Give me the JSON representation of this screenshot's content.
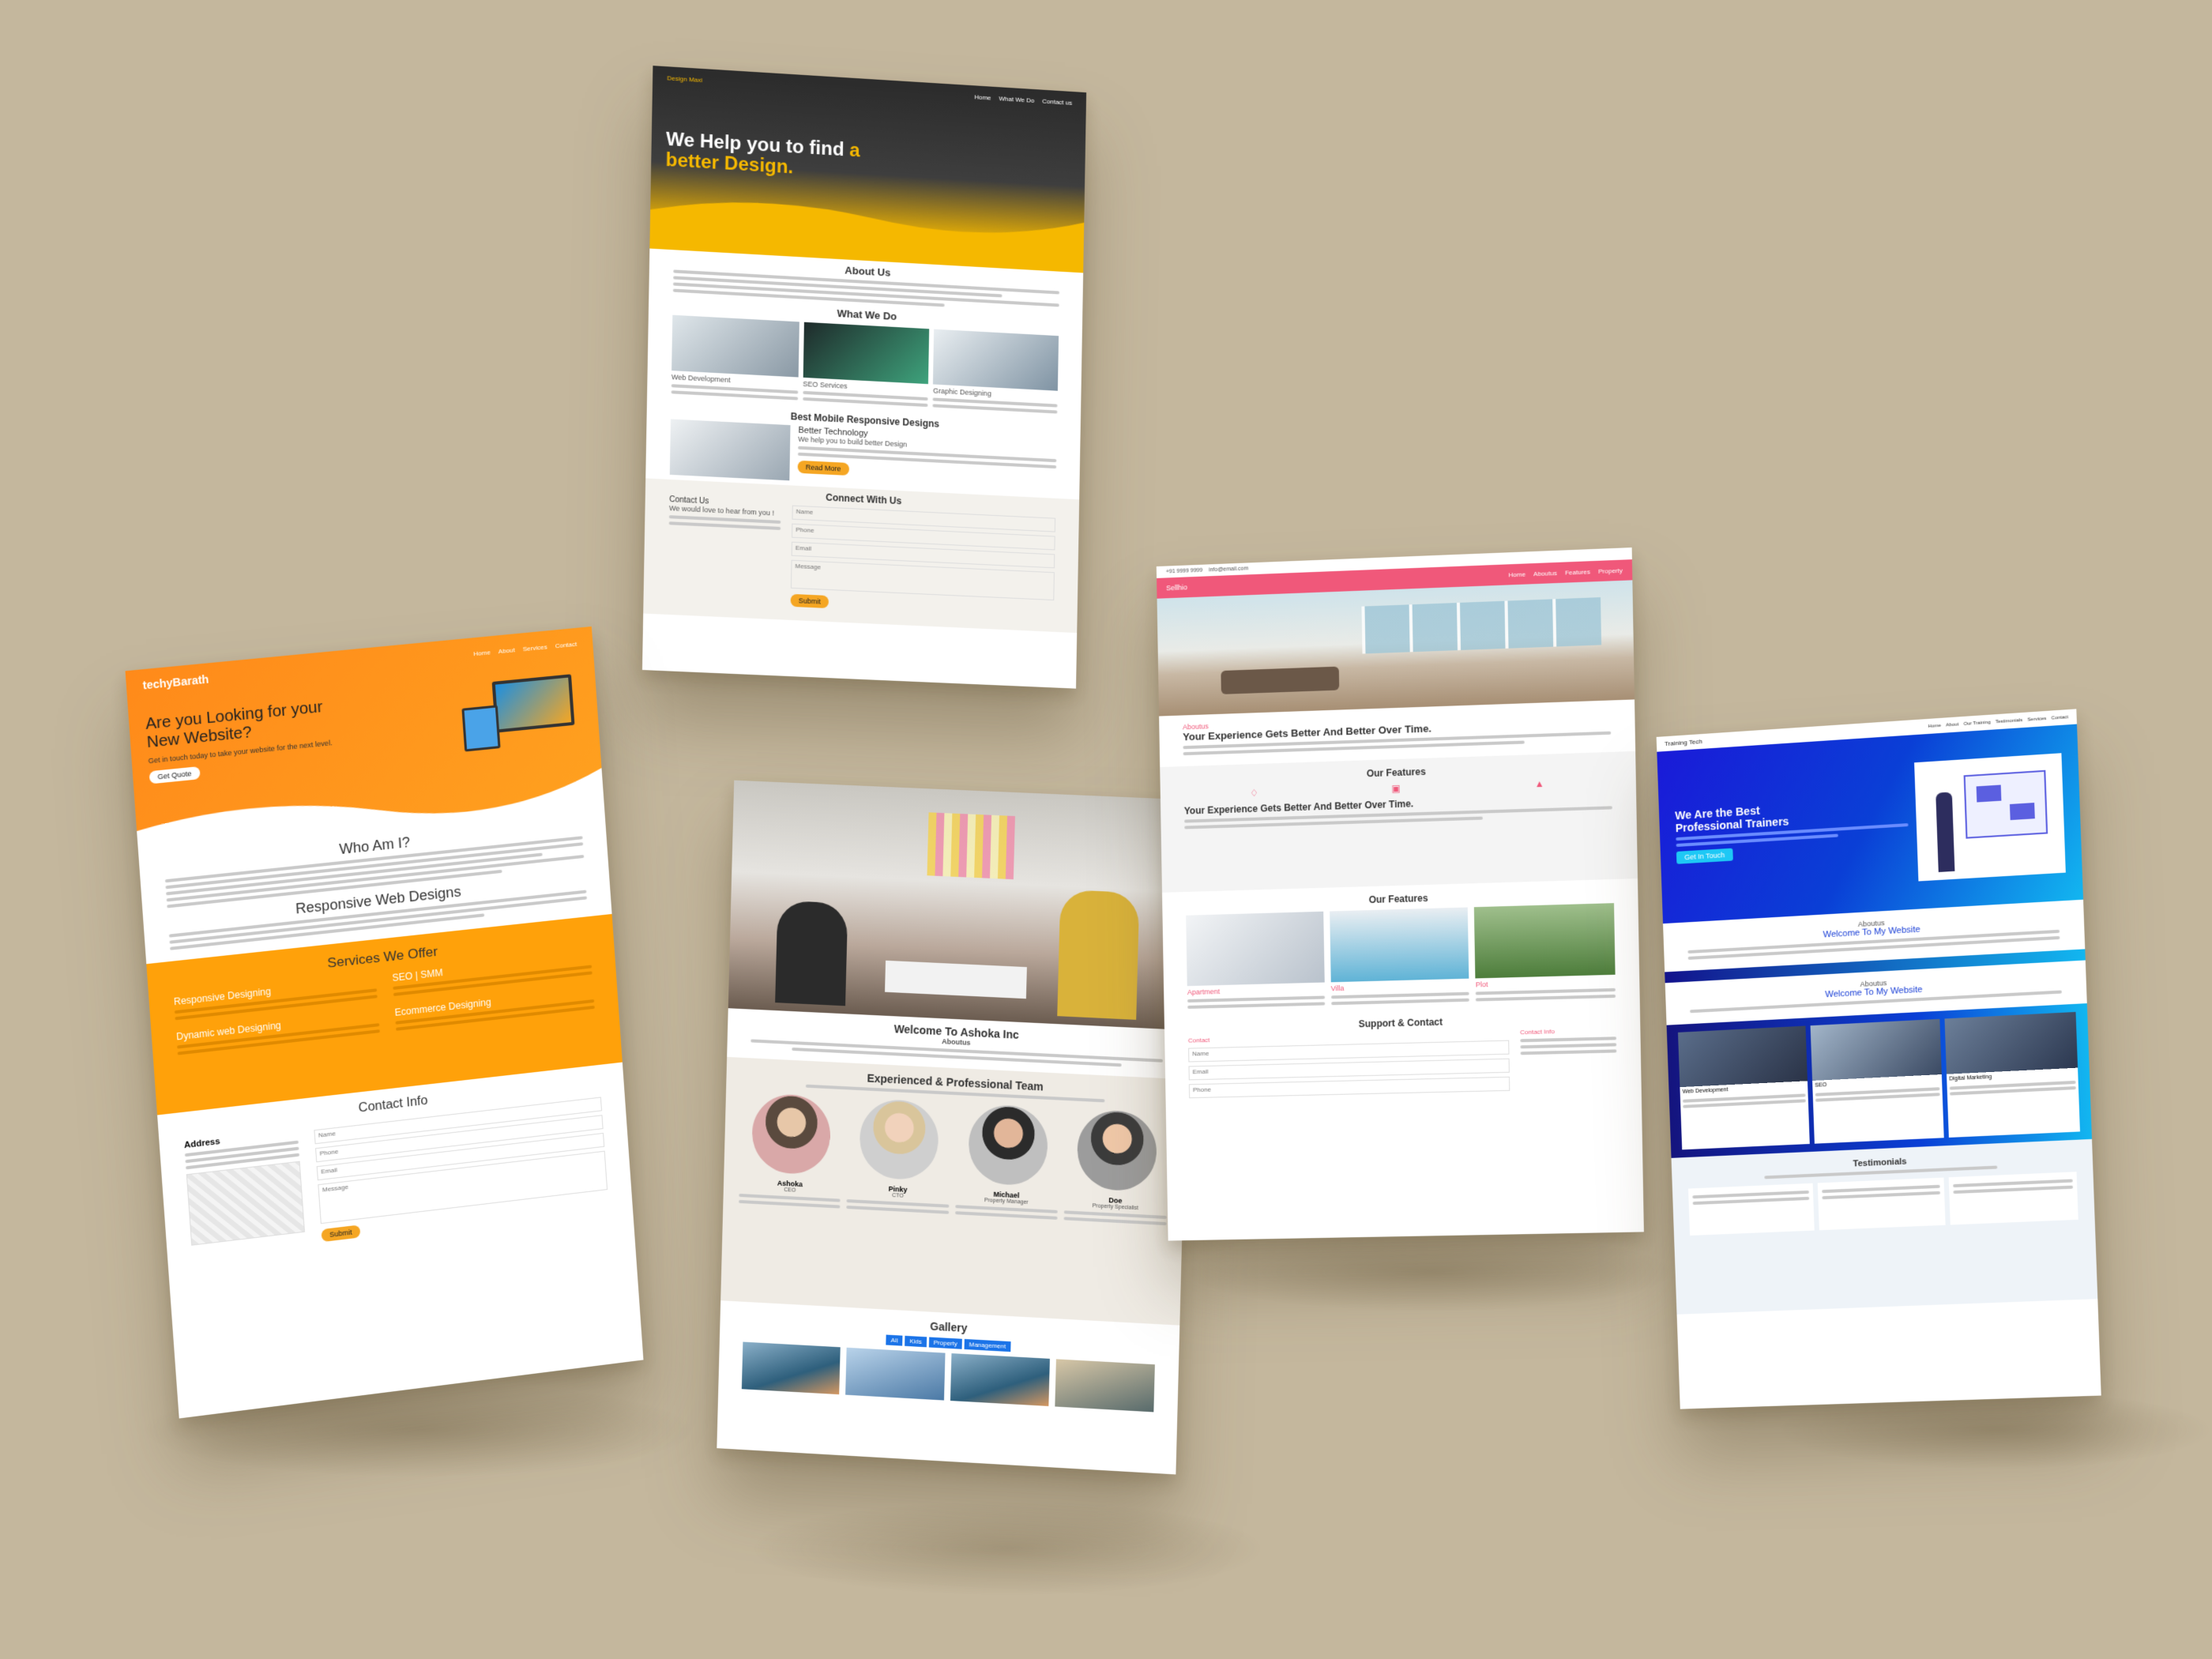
{
  "card_a": {
    "nav_brand": "Design Maxi",
    "nav_links": [
      "Home",
      "What We Do",
      "Contact us"
    ],
    "hero_title_1": "We Help you to find ",
    "hero_title_accent": "a",
    "hero_title_2": "better Design.",
    "about_heading": "About Us",
    "whatwedo_heading": "What We Do",
    "services": [
      {
        "title": "Web Development"
      },
      {
        "title": "SEO Services"
      },
      {
        "title": "Graphic Designing"
      }
    ],
    "mobile_heading": "Best Mobile Responsive Designs",
    "better_tech": "Better Technology",
    "better_sub": "We help you to build better Design",
    "read_more": "Read More",
    "connect_heading": "Connect With Us",
    "contact_heading": "Contact Us",
    "contact_sub": "We would love to hear from you !",
    "fields": [
      "Name",
      "Phone",
      "Email",
      "Message"
    ],
    "submit": "Submit"
  },
  "card_b": {
    "brand": "techyBarath",
    "nav_links": [
      "Home",
      "About",
      "Services",
      "Contact"
    ],
    "hero_title": "Are you Looking for your New Website?",
    "hero_sub": "Get in touch today to take your website for the next level.",
    "hero_btn": "Get Quote",
    "who_heading": "Who Am I?",
    "responsive_heading": "Responsive Web Designs",
    "services_heading": "Services We Offer",
    "services": [
      "Responsive Designing",
      "SEO | SMM",
      "Dynamic web Designing",
      "Ecommerce Designing"
    ],
    "contact_heading": "Contact Info",
    "address_label": "Address",
    "fields": [
      "Name",
      "Phone",
      "Email",
      "Message"
    ],
    "submit": "Submit"
  },
  "card_c": {
    "welcome": "Welcome To Ashoka Inc",
    "welcome_sub": "Aboutus",
    "team_heading": "Experienced & Professional Team",
    "team": [
      {
        "name": "Ashoka",
        "role": "CEO"
      },
      {
        "name": "Pinky",
        "role": "CTO"
      },
      {
        "name": "Michael",
        "role": "Property Manager"
      },
      {
        "name": "Doe",
        "role": "Property Specialist"
      }
    ],
    "gallery_heading": "Gallery",
    "gallery_tabs": [
      "All",
      "Kids",
      "Property",
      "Management"
    ]
  },
  "card_d": {
    "phone": "+91 9999 9999",
    "email": "info@email.com",
    "brand": "Sellhio",
    "nav_links": [
      "Home",
      "Aboutus",
      "Features",
      "Property"
    ],
    "about_label": "Aboutus",
    "experience_heading": "Your Experience Gets Better And Better Over Time.",
    "features_heading": "Our Features",
    "listing": [
      "Apartment",
      "Villa",
      "Plot"
    ],
    "support_heading": "Support & Contact",
    "contact_label": "Contact",
    "contact_info_label": "Contact Info",
    "fields": [
      "Name",
      "Email",
      "Phone"
    ]
  },
  "card_e": {
    "brand": "Training Tech",
    "nav_links": [
      "Home",
      "About",
      "Our Training",
      "Testimonials",
      "Services",
      "Contact"
    ],
    "hero_title": "We Are the Best Professional Trainers",
    "hero_btn": "Get In Touch",
    "about_label": "Aboutus",
    "welcome": "Welcome To My Website",
    "cards": [
      "Web Development",
      "SEO",
      "Digital Marketing"
    ],
    "testimonials_heading": "Testimonials"
  }
}
